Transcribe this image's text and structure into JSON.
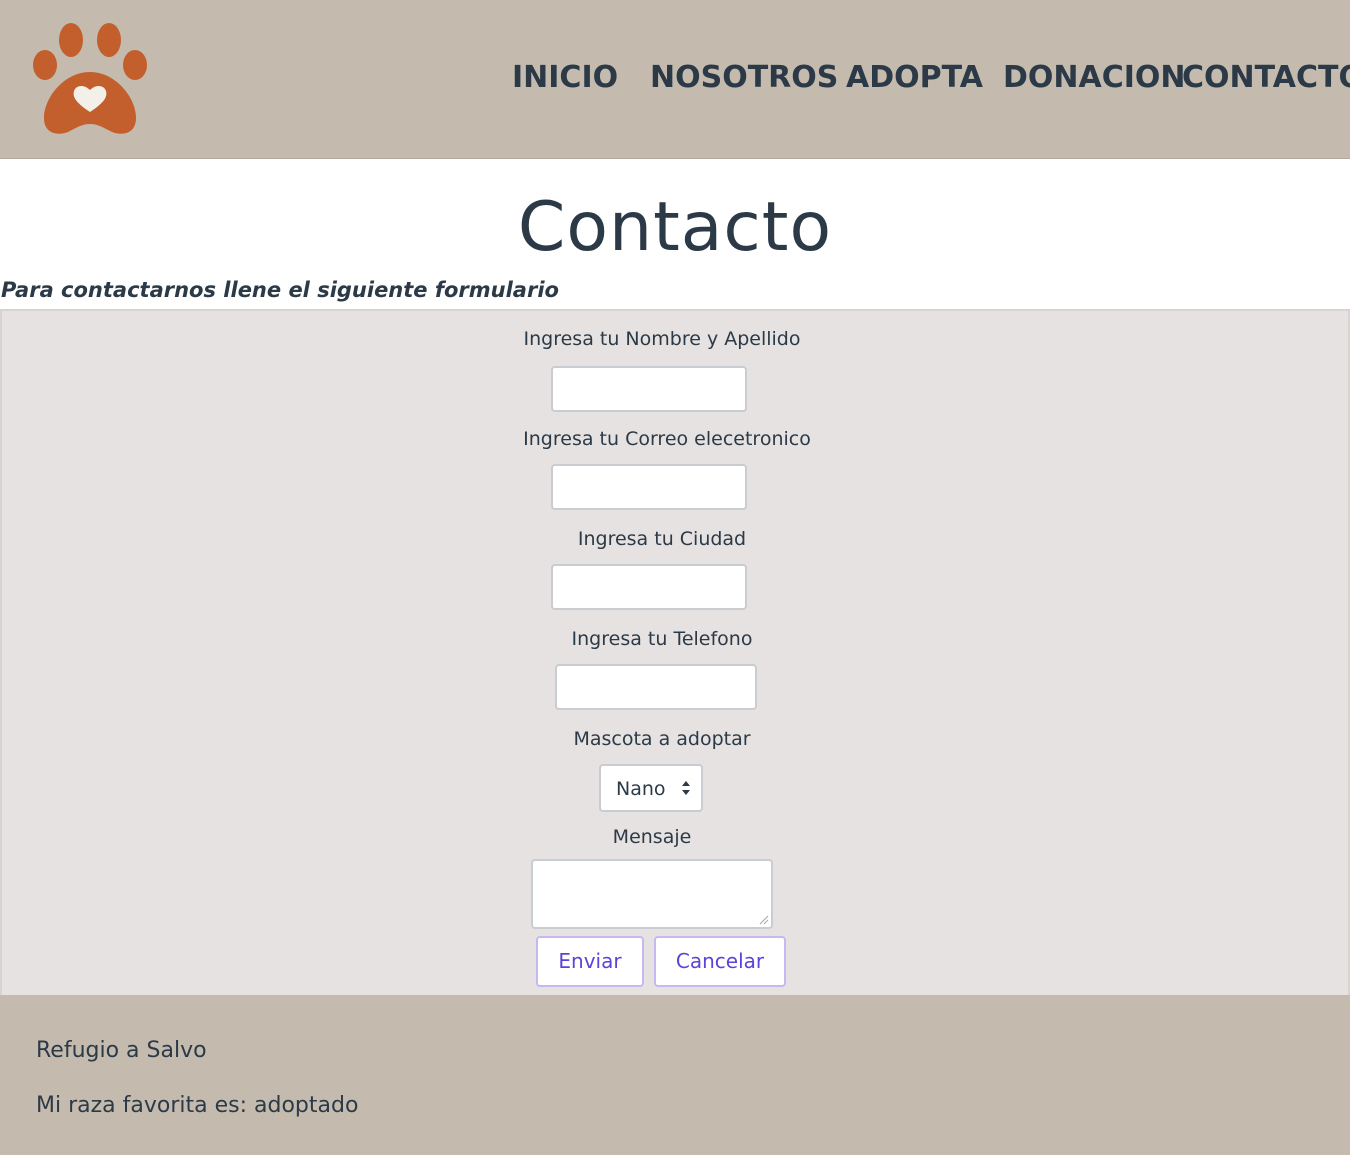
{
  "header": {
    "logo_icon": "paw-heart-icon",
    "nav": {
      "inicio": "INICIO",
      "nosotros": "NOSOTROS",
      "adopta": "ADOPTA",
      "donacion": "DONACION",
      "contacto": "CONTACTO"
    }
  },
  "main": {
    "title": "Contacto",
    "subtitle": "Para contactarnos llene el siguiente formulario",
    "form": {
      "name_label": "Ingresa tu Nombre y Apellido",
      "name_value": "",
      "email_label": "Ingresa tu Correo elecetronico",
      "email_value": "",
      "city_label": "Ingresa tu Ciudad",
      "city_value": "",
      "phone_label": "Ingresa tu Telefono",
      "phone_value": "",
      "pet_label": "Mascota a adoptar",
      "pet_selected": "Nano",
      "message_label": "Mensaje",
      "message_value": "",
      "submit_label": "Enviar",
      "cancel_label": "Cancelar"
    }
  },
  "footer": {
    "line1": "Refugio a Salvo",
    "line2": "Mi raza favorita es: adoptado"
  },
  "colors": {
    "header_bg": "#c4bbae",
    "logo_orange": "#c25f2c",
    "text_dark": "#2c3a47",
    "form_bg": "#e5e2e1",
    "button_text": "#5a45d8",
    "button_border": "#c5b9f2"
  }
}
